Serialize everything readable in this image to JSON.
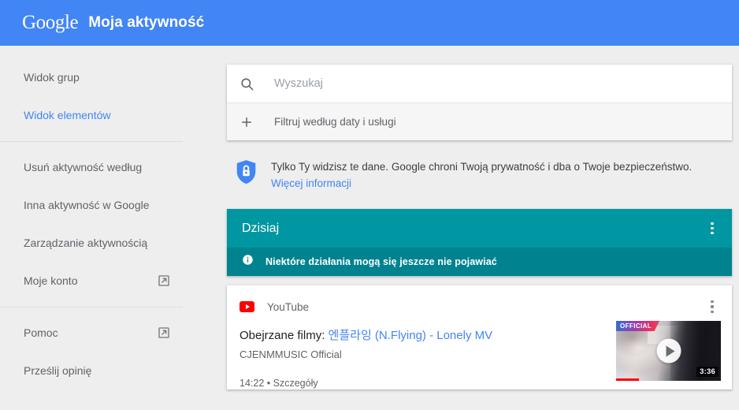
{
  "topbar": {
    "logo": "Google",
    "title": "Moja aktywność"
  },
  "sidebar": {
    "groups": [
      {
        "items": [
          {
            "label": "Widok grup",
            "active": false,
            "external": false
          },
          {
            "label": "Widok elementów",
            "active": true,
            "external": false
          }
        ]
      },
      {
        "items": [
          {
            "label": "Usuń aktywność według",
            "active": false,
            "external": false
          },
          {
            "label": "Inna aktywność w Google",
            "active": false,
            "external": false
          },
          {
            "label": "Zarządzanie aktywnością",
            "active": false,
            "external": false
          },
          {
            "label": "Moje konto",
            "active": false,
            "external": true
          }
        ]
      },
      {
        "items": [
          {
            "label": "Pomoc",
            "active": false,
            "external": true
          },
          {
            "label": "Prześlij opinię",
            "active": false,
            "external": false
          }
        ]
      }
    ]
  },
  "search": {
    "placeholder": "Wyszukaj",
    "value": "",
    "icon": "search-icon",
    "filter_label": "Filtruj według daty i usługi",
    "filter_icon": "plus-icon"
  },
  "privacy": {
    "icon": "shield-lock-icon",
    "message": "Tylko Ty widzisz te dane. Google chroni Twoją prywatność i dba o Twoje bezpieczeństwo.",
    "link": "Więcej informacji",
    "accent": "#4285f4"
  },
  "day_section": {
    "title": "Dzisiaj",
    "header_color": "#0097a2",
    "note_color": "#00838f",
    "note_icon": "info-icon",
    "note": "Niektóre działania mogą się jeszcze nie pojawiać",
    "menu_icon": "more-vert-icon"
  },
  "activity": {
    "source_icon": "youtube-icon",
    "source": "YouTube",
    "menu_icon": "more-vert-icon",
    "title_prefix": "Obejrzane filmy: ",
    "title_link": "엔플라잉 (N.Flying) - Lonely MV",
    "channel": "CJENMMUSIC Official",
    "time": "14:22",
    "separator": "•",
    "details": "Szczegóły",
    "thumbnail": {
      "badge": "OFFICIAL",
      "duration": "3:36",
      "play_icon": "play-circle-icon",
      "progress_percent": 22,
      "progress_color": "#ff0000"
    }
  }
}
